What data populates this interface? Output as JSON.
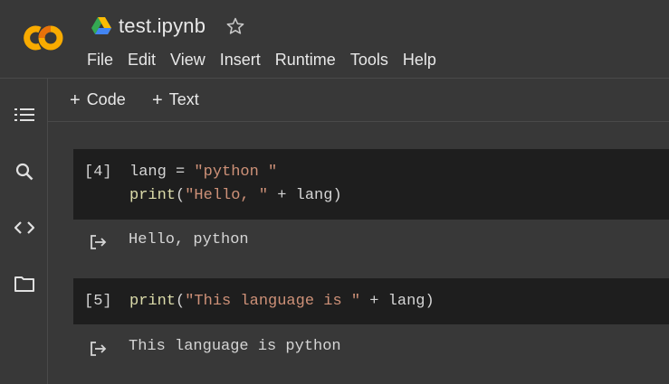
{
  "app": {
    "notebook_title": "test.ipynb",
    "icons": {
      "logo": "colab-logo",
      "drive": "google-drive-icon",
      "star": "star-outline-icon"
    },
    "brand_colors": {
      "logo_orange": "#f9ab00",
      "logo_yellow": "#e8710a"
    }
  },
  "menu": [
    "File",
    "Edit",
    "View",
    "Insert",
    "Runtime",
    "Tools",
    "Help"
  ],
  "toolbar": {
    "add_code_label": "Code",
    "add_text_label": "Text",
    "plus": "+"
  },
  "sidebar": {
    "items": [
      {
        "name": "table-of-contents-icon"
      },
      {
        "name": "search-icon"
      },
      {
        "name": "code-snippets-icon"
      },
      {
        "name": "files-folder-icon"
      }
    ]
  },
  "cells": [
    {
      "exec_count": "[4]",
      "line1": {
        "var": "lang = ",
        "str": "\"python \""
      },
      "line2": {
        "fn": "print",
        "open": "(",
        "str": "\"Hello, \"",
        "rest": " + lang)"
      },
      "output": "Hello, python"
    },
    {
      "exec_count": "[5]",
      "line1": {
        "fn": "print",
        "open": "(",
        "str": "\"This language is \"",
        "rest": " + lang)"
      },
      "output": "This language is python"
    }
  ]
}
